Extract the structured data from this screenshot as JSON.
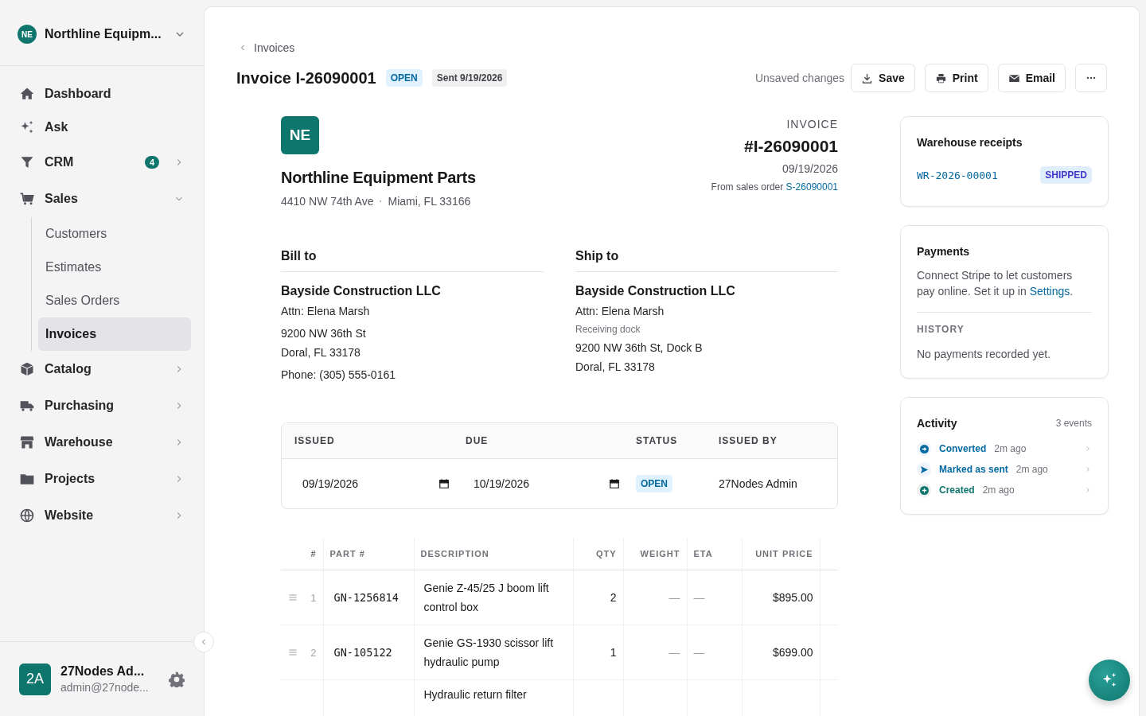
{
  "org": {
    "initials": "NE",
    "name": "Northline Equipm..."
  },
  "nav": [
    {
      "label": "Dashboard",
      "kind": "home",
      "selected": false
    },
    {
      "label": "Ask",
      "kind": "sparkle",
      "selected": false
    },
    {
      "label": "CRM",
      "kind": "funnel",
      "selected": false,
      "badge": "4",
      "expanded": false
    },
    {
      "label": "Sales",
      "kind": "cart",
      "selected": false,
      "expanded": true,
      "children": [
        {
          "label": "Customers",
          "selected": false
        },
        {
          "label": "Estimates",
          "selected": false
        },
        {
          "label": "Sales Orders",
          "selected": false
        },
        {
          "label": "Invoices",
          "selected": true
        }
      ]
    },
    {
      "label": "Catalog",
      "kind": "cube",
      "selected": false,
      "expanded": false
    },
    {
      "label": "Purchasing",
      "kind": "truck",
      "selected": false,
      "expanded": false
    },
    {
      "label": "Warehouse",
      "kind": "store",
      "selected": false,
      "expanded": false
    },
    {
      "label": "Projects",
      "kind": "folder",
      "selected": false,
      "expanded": false
    },
    {
      "label": "Website",
      "kind": "globe",
      "selected": false,
      "expanded": false
    }
  ],
  "user": {
    "initials": "2A",
    "name": "27Nodes Ad...",
    "email": "admin@27node..."
  },
  "breadcrumb": "Invoices",
  "title": "Invoice I-26090001",
  "title_badges": [
    {
      "text": "OPEN",
      "kind": "status"
    },
    {
      "text": "Sent 9/19/2026",
      "kind": "neutral"
    }
  ],
  "unsaved": "Unsaved changes",
  "actions": [
    {
      "label": "Save",
      "kind": "download"
    },
    {
      "label": "Print",
      "kind": "printer"
    },
    {
      "label": "Email",
      "kind": "mail"
    },
    {
      "kind": "more"
    }
  ],
  "document": {
    "company": {
      "initials": "NE",
      "name": "Northline Equipment Parts",
      "address": [
        "4410 NW 74th Ave",
        "Miami, FL 33166"
      ]
    },
    "doc_label": "INVOICE",
    "number": "#I-26090001",
    "date": "09/19/2026",
    "source_prefix": "From sales order",
    "source_link": "S-26090001",
    "parties": [
      {
        "heading": "Bill to",
        "name": "Bayside Construction LLC",
        "lines": [
          {
            "text": "Attn: Elena Marsh",
            "kind": "line"
          },
          {
            "text": "9200 NW 36th St",
            "kind": "line"
          },
          {
            "text": "Doral, FL 33178",
            "kind": "line"
          },
          {
            "text": "Phone: (305) 555-0161",
            "kind": "line"
          }
        ]
      },
      {
        "heading": "Ship to",
        "name": "Bayside Construction LLC",
        "lines": [
          {
            "text": "Attn: Elena Marsh",
            "kind": "line"
          },
          {
            "text": "Receiving dock",
            "kind": "note"
          },
          {
            "text": "9200 NW 36th St, Dock B",
            "kind": "line"
          },
          {
            "text": "Doral, FL 33178",
            "kind": "line"
          }
        ]
      }
    ],
    "meta": {
      "columns": [
        "ISSUED",
        "DUE",
        "STATUS",
        "ISSUED BY"
      ],
      "issued": "09/19/2026",
      "due": "10/19/2026",
      "status": "OPEN",
      "issued_by": "27Nodes Admin"
    },
    "lines": {
      "columns": [
        "#",
        "PART #",
        "DESCRIPTION",
        "QTY",
        "WEIGHT",
        "ETA",
        "UNIT PRICE"
      ],
      "rows": [
        {
          "num": "1",
          "part": "GN-1256814",
          "description": "Genie Z-45/25 J boom lift control box",
          "qty": "2",
          "weight": "—",
          "eta": "—",
          "unit_price": "$895.00"
        },
        {
          "num": "2",
          "part": "GN-105122",
          "description": "Genie GS-1930 scissor lift hydraulic pump",
          "qty": "1",
          "weight": "—",
          "eta": "—",
          "unit_price": "$699.00"
        },
        {
          "description": "Hydraulic return filter"
        }
      ]
    }
  },
  "receipts": {
    "title": "Warehouse receipts",
    "items": [
      {
        "id": "WR-2026-00001",
        "status": "SHIPPED"
      }
    ]
  },
  "payments": {
    "title": "Payments",
    "text": "Connect Stripe to let customers pay online. Set it up in",
    "link": "Settings",
    "suffix": ".",
    "history_label": "HISTORY",
    "history_text": "No payments recorded yet."
  },
  "activity": {
    "title": "Activity",
    "count": "3 events",
    "events": [
      {
        "label": "Converted",
        "time": "2m ago",
        "kind": "converted"
      },
      {
        "label": "Marked as sent",
        "time": "2m ago",
        "kind": "sent"
      },
      {
        "label": "Created",
        "time": "2m ago",
        "kind": "created"
      }
    ]
  }
}
